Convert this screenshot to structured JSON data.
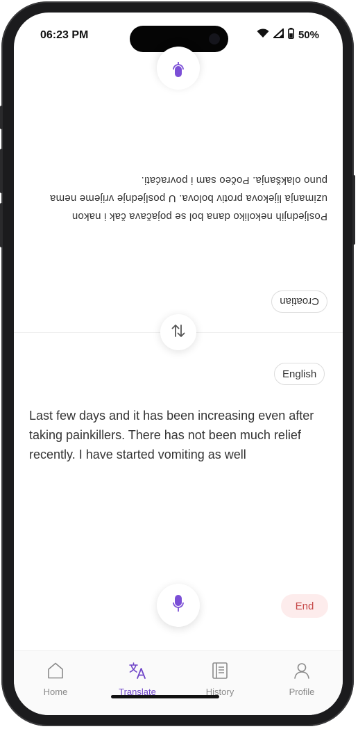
{
  "status_bar": {
    "time": "06:23 PM",
    "battery": "50%"
  },
  "colors": {
    "accent": "#6f45c8",
    "end_bg": "#fdecec",
    "end_text": "#c64747"
  },
  "source_panel": {
    "language": "Croatian",
    "text": "Posljednjih nekoliko dana bol se pojačava čak i nakon uzimanja lijekova protiv bolova. U posljednje vrijeme nema puno olakšanja. Počeo sam i povraćati."
  },
  "target_panel": {
    "language": "English",
    "text": "Last few days and it has been increasing even after taking painkillers. There has not been much relief recently. I have started vomiting as well"
  },
  "controls": {
    "end_label": "End"
  },
  "icons": {
    "mic": "microphone-icon",
    "swap": "swap-arrows-icon"
  },
  "tab_bar": {
    "items": [
      {
        "label": "Home",
        "icon": "home-icon"
      },
      {
        "label": "Translate",
        "icon": "translate-icon",
        "active": true
      },
      {
        "label": "History",
        "icon": "history-icon"
      },
      {
        "label": "Profile",
        "icon": "profile-icon"
      }
    ]
  }
}
